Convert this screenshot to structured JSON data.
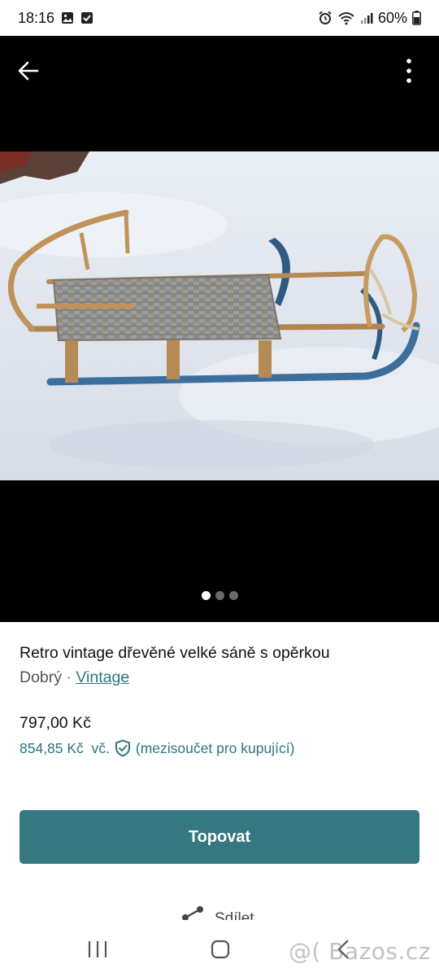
{
  "status_bar": {
    "time": "18:16",
    "battery": "60%",
    "icons": [
      "gallery-icon",
      "check-icon",
      "alarm-icon",
      "wifi-icon",
      "signal-icon",
      "battery-icon"
    ]
  },
  "toolbar": {
    "back_icon": "arrow-left-icon",
    "more_icon": "more-vertical-icon"
  },
  "gallery": {
    "image_count": 3,
    "active_index": 0
  },
  "listing": {
    "title": "Retro vintage dřevěné velké sáně s opěrkou",
    "condition": "Dobrý",
    "separator": "·",
    "category": "Vintage",
    "price": "797,00 Kč",
    "buyer_price": "854,85 Kč  vč.",
    "buyer_note": "(mezisoučet pro kupující)"
  },
  "actions": {
    "boost_label": "Topovat",
    "share_label": "Sdílet"
  },
  "nav_bar": {
    "watermark": "@( Bazos.cz"
  },
  "colors": {
    "accent": "#36787f",
    "link": "#2d7680",
    "gallery_bg": "#000000"
  }
}
